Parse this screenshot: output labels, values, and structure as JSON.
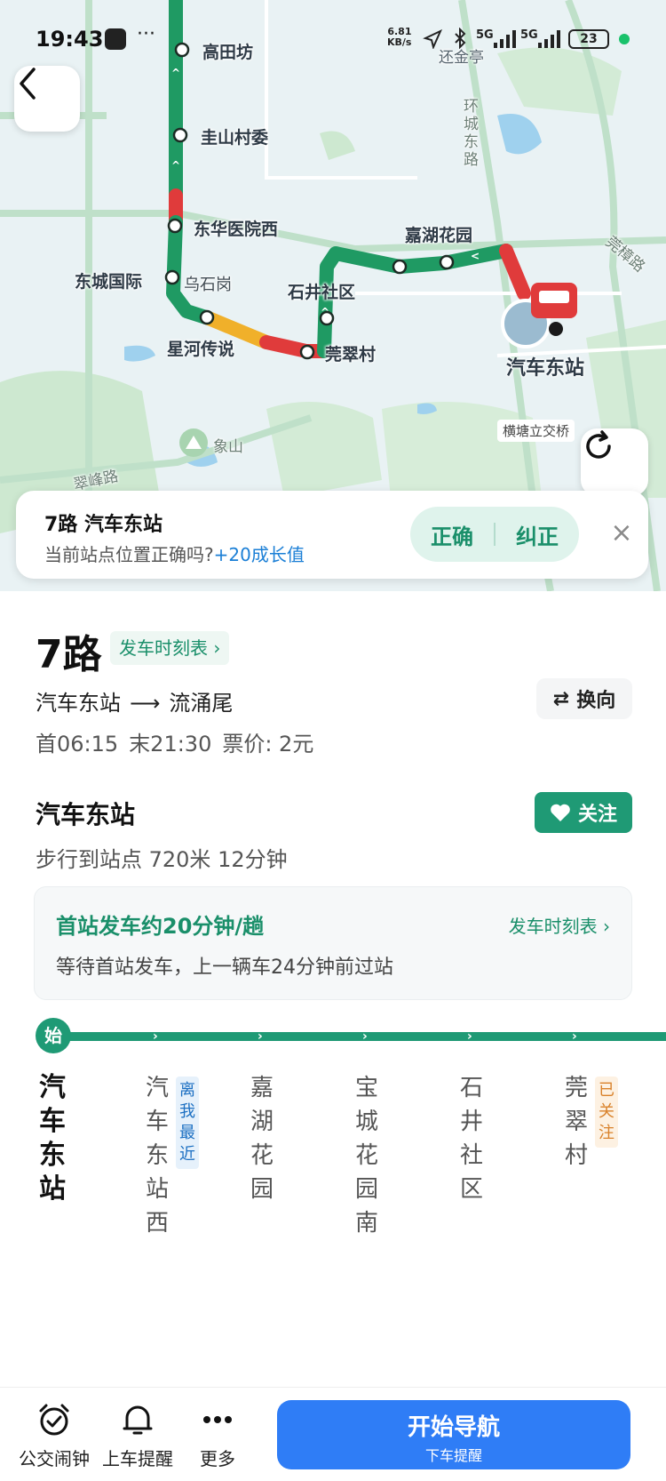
{
  "status_bar": {
    "time": "19:43",
    "net_speed": "6.81",
    "net_unit": "KB/s",
    "signal_1": "5G",
    "signal_2": "5G",
    "battery": "23"
  },
  "map": {
    "labels": {
      "gaotianfang": "高田坊",
      "zhushan": "圭山村委",
      "donghua": "东华医院西",
      "dongcheng": "东城国际",
      "wushigang": "乌石岗",
      "xinghe": "星河传说",
      "shijing": "石井社区",
      "jiahu": "嘉湖花园",
      "guancui": "莞翠村",
      "station": "汽车东站",
      "huancheng_road": "环城东路",
      "guanzhang_road": "莞樟路",
      "cuifeng_road": "翠峰路",
      "xiangshan": "象山",
      "huanjin": "还金亭",
      "hengtang": "横塘立交桥"
    },
    "colors": {
      "route_green": "#1f9a63",
      "route_red": "#e03b3b",
      "route_yellow": "#f0b02a"
    }
  },
  "confirm_card": {
    "title": "7路 汽车东站",
    "question": "当前站点位置正确吗?",
    "bonus": "+20成长值",
    "correct_label": "正确",
    "fix_label": "纠正",
    "close_icon": "×"
  },
  "route": {
    "name": "7路",
    "timetable_link": "发车时刻表 ›",
    "from": "汽车东站",
    "to": "流涌尾",
    "swap_label": "换向",
    "first_bus": "首06:15",
    "last_bus": "末21:30",
    "fare": "票价: 2元"
  },
  "stop": {
    "name": "汽车东站",
    "follow_label": "关注",
    "walk_info": "步行到站点 720米 12分钟"
  },
  "dispatch": {
    "headline": "首站发车约20分钟/趟",
    "timetable_link": "发车时刻表 ›",
    "detail": "等待首站发车，上一辆车24分钟前过站"
  },
  "stops_strip": {
    "start_badge": "始",
    "stops": [
      "汽车东站",
      "汽车东站西",
      "嘉湖花园",
      "宝城花园南",
      "石井社区",
      "莞翠村"
    ],
    "tag_nearest": "离我最近",
    "tag_followed": "已关注"
  },
  "bottom_bar": {
    "alarm_label": "公交闹钟",
    "remind_label": "上车提醒",
    "more_label": "更多",
    "nav_main": "开始导航",
    "nav_sub": "下车提醒"
  }
}
